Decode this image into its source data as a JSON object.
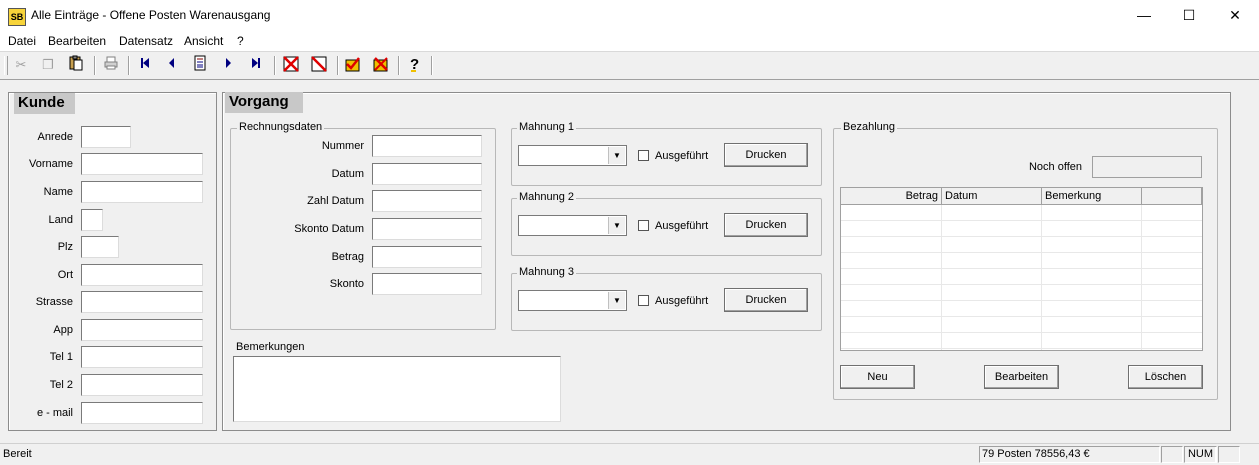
{
  "window": {
    "app_icon": "SB",
    "title": "Alle Einträge - Offene Posten Warenausgang",
    "minimize": "—",
    "maximize": "☐",
    "close": "✕"
  },
  "menu": [
    "Datei",
    "Bearbeiten",
    "Datensatz",
    "Ansicht",
    "?"
  ],
  "toolbar": {
    "icons": [
      "cut-icon",
      "copy-icon",
      "paste-icon",
      "print-icon",
      "first-record-icon",
      "prev-record-icon",
      "new-record-icon",
      "next-record-icon",
      "last-record-icon",
      "delete-red-x-icon",
      "delete-filter-icon",
      "mark-icon",
      "mark2-icon",
      "help-icon"
    ]
  },
  "kunde": {
    "title": "Kunde",
    "fields": [
      {
        "label": "Anrede",
        "value": ""
      },
      {
        "label": "Vorname",
        "value": ""
      },
      {
        "label": "Name",
        "value": ""
      },
      {
        "label": "Land",
        "value": ""
      },
      {
        "label": "Plz",
        "value": ""
      },
      {
        "label": "Ort",
        "value": ""
      },
      {
        "label": "Strasse",
        "value": ""
      },
      {
        "label": "App",
        "value": ""
      },
      {
        "label": "Tel 1",
        "value": ""
      },
      {
        "label": "Tel 2",
        "value": ""
      },
      {
        "label": "e - mail",
        "value": ""
      }
    ]
  },
  "vorgang": {
    "title": "Vorgang",
    "rechnungsdaten": {
      "label": "Rechnungsdaten",
      "fields": [
        {
          "label": "Nummer",
          "value": ""
        },
        {
          "label": "Datum",
          "value": ""
        },
        {
          "label": "Zahl Datum",
          "value": ""
        },
        {
          "label": "Skonto Datum",
          "value": ""
        },
        {
          "label": "Betrag",
          "value": ""
        },
        {
          "label": "Skonto",
          "value": ""
        }
      ]
    },
    "bemerkungen": {
      "label": "Bemerkungen",
      "value": ""
    },
    "mahnungen": [
      {
        "label": "Mahnung 1",
        "selected": "",
        "check_label": "Ausgeführt",
        "button": "Drucken"
      },
      {
        "label": "Mahnung 2",
        "selected": "",
        "check_label": "Ausgeführt",
        "button": "Drucken"
      },
      {
        "label": "Mahnung 3",
        "selected": "",
        "check_label": "Ausgeführt",
        "button": "Drucken"
      }
    ],
    "bezahlung": {
      "label": "Bezahlung",
      "noch_offen_label": "Noch offen",
      "noch_offen_value": "",
      "columns": [
        "Betrag",
        "Datum",
        "Bemerkung",
        ""
      ],
      "rows": [],
      "buttons": {
        "neu": "Neu",
        "bearbeiten": "Bearbeiten",
        "loeschen": "Löschen"
      }
    }
  },
  "status": {
    "text": "Bereit",
    "posten": "79 Posten   78556,43 €",
    "pane2": "",
    "pane3": "",
    "num": "NUM",
    "pane5": ""
  }
}
